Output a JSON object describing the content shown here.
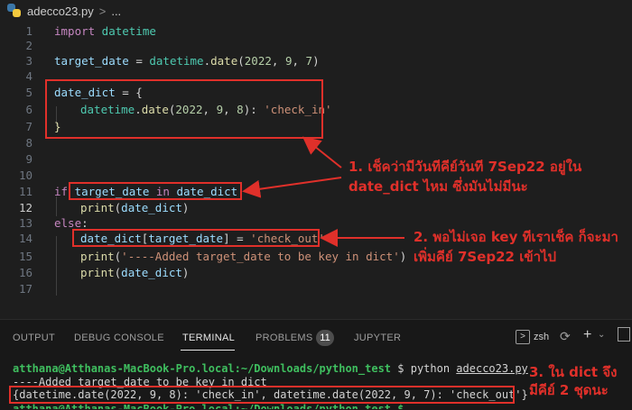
{
  "breadcrumb": {
    "file": "adecco23.py",
    "sep": ">",
    "more": "..."
  },
  "code_lines": [
    {
      "n": "1"
    },
    {
      "n": "2"
    },
    {
      "n": "3"
    },
    {
      "n": "4"
    },
    {
      "n": "5"
    },
    {
      "n": "6"
    },
    {
      "n": "7"
    },
    {
      "n": "8"
    },
    {
      "n": "9"
    },
    {
      "n": "10"
    },
    {
      "n": "11"
    },
    {
      "n": "12"
    },
    {
      "n": "13"
    },
    {
      "n": "14"
    },
    {
      "n": "15"
    },
    {
      "n": "16"
    },
    {
      "n": "17"
    }
  ],
  "code": {
    "l1_kw": "import",
    "l1_mod": " datetime",
    "l3_var": "target_date",
    "l3_eq": " = ",
    "l3_mod": "datetime",
    "l3_dot": ".",
    "l3_fn": "date",
    "l3_args_open": "(",
    "l3_a1": "2022",
    "l3_c1": ", ",
    "l3_a2": "9",
    "l3_c2": ", ",
    "l3_a3": "7",
    "l3_close": ")",
    "l5_var": "date_dict",
    "l5_eq": " = {",
    "l6_mod": "datetime",
    "l6_dot": ".",
    "l6_fn": "date",
    "l6_open": "(",
    "l6_a1": "2022",
    "l6_c1": ", ",
    "l6_a2": "9",
    "l6_c2": ", ",
    "l6_a3": "8",
    "l6_close": "): ",
    "l6_str": "'check_in'",
    "l7": "}",
    "l11_kw": "if",
    "l11_var1": " target_date",
    "l11_in": " in",
    "l11_var2": " date_dict",
    "l11_colon": ":",
    "l12_fn": "print",
    "l12_open": "(",
    "l12_var": "date_dict",
    "l12_close": ")",
    "l13_kw": "else",
    "l13_colon": ":",
    "l14_var1": "date_dict",
    "l14_open": "[",
    "l14_var2": "target_date",
    "l14_close": "] = ",
    "l14_str": "'check_out'",
    "l15_fn": "print",
    "l15_open": "(",
    "l15_str": "'----Added target_date to be key in dict'",
    "l15_close": ")",
    "l16_fn": "print",
    "l16_open": "(",
    "l16_var": "date_dict",
    "l16_close": ")"
  },
  "annotations": {
    "a1_line1": "1. เช็คว่ามีวันทีคีย์วันที 7Sep22 อยู่ใน",
    "a1_line2": "date_dict ไหม ซึ่งมันไม่มีนะ",
    "a2_line1": "2. พอไม่เจอ key ทีเราเช็ค ก็จะมา",
    "a2_line2": "เพิ่มคีย์ 7Sep22 เข้าไป",
    "a3_line1": "3. ใน dict จึง",
    "a3_line2": "มีคีย์ 2 ชุดนะ"
  },
  "panel": {
    "tabs": [
      "OUTPUT",
      "DEBUG CONSOLE",
      "TERMINAL",
      "PROBLEMS",
      "JUPYTER"
    ],
    "active_tab": "TERMINAL",
    "problems_count": "11",
    "shell_label": "zsh"
  },
  "terminal": {
    "prompt": "atthana@Atthanas-MacBook-Pro.local:~/Downloads/python_test",
    "prompt_symbol": " $ ",
    "command": "python ",
    "command_file": "adecco23.py",
    "output1": "----Added target_date to be key in dict",
    "output2": "{datetime.date(2022, 9, 8): 'check_in', datetime.date(2022, 9, 7): 'check_out'}",
    "next_prompt": "atthana@Atthanas-MacBook-Pro.local:~/Downloads/python_test $"
  },
  "colors": {
    "accent_red": "#e0302a",
    "terminal_green": "#3fbf5f",
    "terminal_blue": "#4fa0ff"
  }
}
